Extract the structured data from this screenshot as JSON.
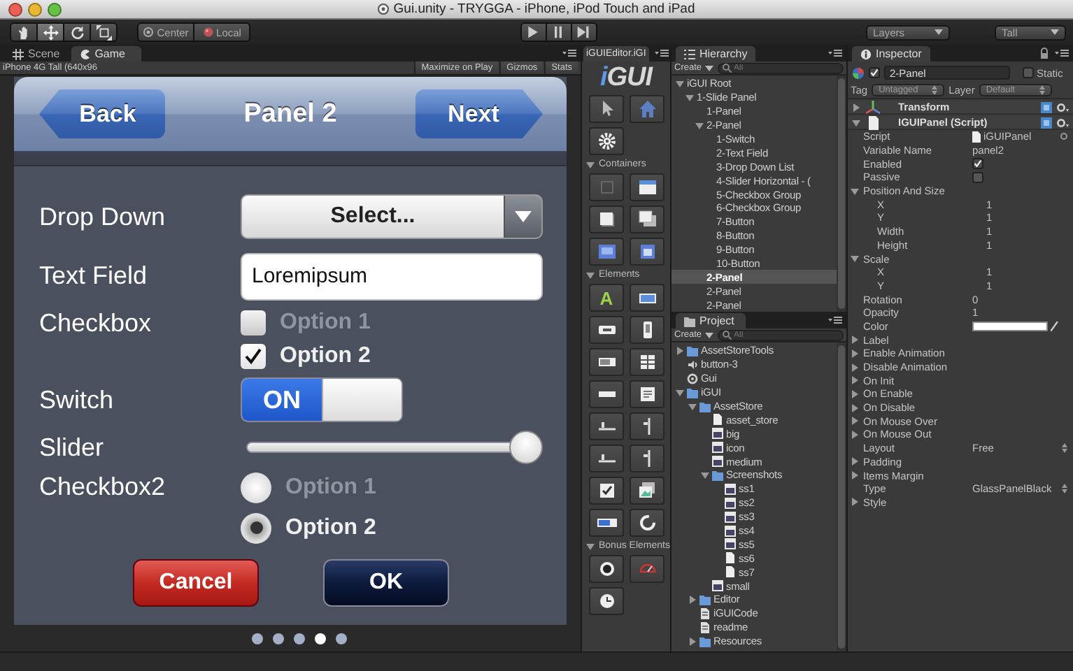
{
  "window": {
    "title": "Gui.unity - TRYGGA - iPhone, iPod Touch and iPad"
  },
  "toolbar": {
    "tools": [
      {
        "kind": "hand",
        "selected": false
      },
      {
        "kind": "move",
        "selected": true
      },
      {
        "kind": "rotate",
        "selected": false
      },
      {
        "kind": "scale",
        "selected": false
      }
    ],
    "pivot": [
      {
        "kind": "center",
        "label": "Center"
      },
      {
        "kind": "local",
        "label": "Local"
      }
    ],
    "playback": [
      {
        "kind": "play"
      },
      {
        "kind": "pause"
      },
      {
        "kind": "step"
      }
    ],
    "layers": "Layers",
    "layout": "Tall"
  },
  "game": {
    "tabs": [
      {
        "kind": "scene",
        "label": "Scene",
        "selected": false
      },
      {
        "kind": "game",
        "label": "Game",
        "selected": true
      }
    ],
    "resolution": "iPhone 4G Tall (640x96",
    "options": [
      "Maximize on Play",
      "Gizmos",
      "Stats"
    ],
    "app": {
      "back": "Back",
      "title": "Panel 2",
      "next": "Next",
      "rows": [
        {
          "kind": "dropdown",
          "label": "Drop Down",
          "value": "Select..."
        },
        {
          "kind": "text",
          "label": "Text Field",
          "value": "Loremipsum"
        },
        {
          "kind": "checkboxes",
          "label": "Checkbox",
          "options": [
            {
              "label": "Option 1",
              "checked": false
            },
            {
              "label": "Option 2",
              "checked": true
            }
          ]
        },
        {
          "kind": "switch",
          "label": "Switch",
          "on": true,
          "text": "ON"
        },
        {
          "kind": "slider",
          "label": "Slider",
          "level": 1
        },
        {
          "kind": "radios",
          "label": "Checkbox2",
          "options": [
            {
              "label": "Option 1",
              "selected": false
            },
            {
              "label": "Option 2",
              "selected": true
            }
          ]
        }
      ],
      "buttons": [
        {
          "kind": "cancel",
          "label": "Cancel"
        },
        {
          "kind": "ok",
          "label": "OK"
        }
      ],
      "pages": [
        {
          "selected": false
        },
        {
          "selected": false
        },
        {
          "selected": false
        },
        {
          "selected": true
        },
        {
          "selected": false
        }
      ]
    }
  },
  "editor": {
    "tab": "iGUIEditor.iGI",
    "logo": "iGUI",
    "sections": [
      {
        "tools": [
          {
            "kind": "pointer"
          },
          {
            "kind": "home"
          },
          {
            "kind": "gear"
          }
        ]
      },
      {
        "label": "Containers",
        "expanded": true,
        "tools": [
          {
            "kind": "blank"
          },
          {
            "kind": "window"
          },
          {
            "kind": "panel"
          },
          {
            "kind": "panels"
          },
          {
            "kind": "scroll"
          },
          {
            "kind": "tabs"
          }
        ]
      },
      {
        "label": "Elements",
        "expanded": true,
        "tools": [
          {
            "kind": "label",
            "glyph": "A"
          },
          {
            "kind": "textfield"
          },
          {
            "kind": "button"
          },
          {
            "kind": "toggle"
          },
          {
            "kind": "listbox"
          },
          {
            "kind": "grid"
          },
          {
            "kind": "line"
          },
          {
            "kind": "textarea"
          },
          {
            "kind": "hslider"
          },
          {
            "kind": "vslider"
          },
          {
            "kind": "hslider"
          },
          {
            "kind": "vslider"
          },
          {
            "kind": "checkbox"
          },
          {
            "kind": "image"
          },
          {
            "kind": "progress"
          },
          {
            "kind": "ring"
          }
        ]
      },
      {
        "label": "Bonus Elements",
        "expanded": true,
        "tools": [
          {
            "kind": "knob"
          },
          {
            "kind": "gauge"
          },
          {
            "kind": "clock"
          }
        ]
      }
    ]
  },
  "hierarchy": {
    "tab": "Hierarchy",
    "create": "Create",
    "search": {
      "placeholder": "All"
    },
    "items": [
      {
        "label": "iGUI Root",
        "selected": false,
        "expanded": true,
        "children": [
          {
            "label": "1-Slide Panel",
            "selected": false,
            "expanded": true,
            "children": [
              {
                "label": "1-Panel",
                "selected": false
              },
              {
                "label": "2-Panel",
                "selected": false,
                "expanded": true,
                "children": [
                  {
                    "label": "1-Switch",
                    "selected": false
                  },
                  {
                    "label": "2-Text Field",
                    "selected": false
                  },
                  {
                    "label": "3-Drop Down List",
                    "selected": false
                  },
                  {
                    "label": "4-Slider Horizontal - (",
                    "selected": false
                  },
                  {
                    "label": "5-Checkbox Group",
                    "selected": false
                  },
                  {
                    "label": "6-Checkbox Group",
                    "selected": false
                  },
                  {
                    "label": "7-Button",
                    "selected": false
                  },
                  {
                    "label": "8-Button",
                    "selected": false
                  },
                  {
                    "label": "9-Button",
                    "selected": false
                  },
                  {
                    "label": "10-Button",
                    "selected": false
                  }
                ]
              },
              {
                "label": "2-Panel",
                "selected": true
              },
              {
                "label": "2-Panel",
                "selected": false
              },
              {
                "label": "2-Panel",
                "selected": false
              }
            ]
          }
        ]
      }
    ]
  },
  "project": {
    "tab": "Project",
    "create": "Create",
    "search": {
      "placeholder": "All"
    },
    "items": [
      {
        "kind": "folder",
        "label": "AssetStoreTools",
        "selected": false,
        "expanded": false
      },
      {
        "kind": "audio",
        "label": "button-3",
        "selected": false
      },
      {
        "kind": "scene",
        "label": "Gui",
        "selected": false
      },
      {
        "kind": "folder",
        "label": "iGUI",
        "selected": false,
        "expanded": true,
        "children": [
          {
            "kind": "folder",
            "label": "AssetStore",
            "selected": false,
            "expanded": true,
            "children": [
              {
                "kind": "page",
                "label": "asset_store",
                "selected": false
              },
              {
                "kind": "image",
                "label": "big",
                "selected": false
              },
              {
                "kind": "image",
                "label": "icon",
                "selected": false
              },
              {
                "kind": "image",
                "label": "medium",
                "selected": false
              },
              {
                "kind": "folder",
                "label": "Screenshots",
                "selected": false,
                "expanded": true,
                "children": [
                  {
                    "kind": "image",
                    "label": "ss1",
                    "selected": false
                  },
                  {
                    "kind": "image",
                    "label": "ss2",
                    "selected": false
                  },
                  {
                    "kind": "image",
                    "label": "ss3",
                    "selected": false
                  },
                  {
                    "kind": "image",
                    "label": "ss4",
                    "selected": false
                  },
                  {
                    "kind": "image",
                    "label": "ss5",
                    "selected": false
                  },
                  {
                    "kind": "page",
                    "label": "ss6",
                    "selected": false
                  },
                  {
                    "kind": "page",
                    "label": "ss7",
                    "selected": false
                  }
                ]
              },
              {
                "kind": "image",
                "label": "small",
                "selected": false
              }
            ]
          },
          {
            "kind": "folder",
            "label": "Editor",
            "selected": false,
            "expanded": false
          },
          {
            "kind": "script",
            "label": "iGUICode",
            "selected": false
          },
          {
            "kind": "script",
            "label": "readme",
            "selected": false
          },
          {
            "kind": "folder",
            "label": "Resources",
            "selected": false,
            "expanded": false
          }
        ]
      }
    ]
  },
  "inspector": {
    "tab": "Inspector",
    "object": {
      "active": true,
      "name": "2-Panel",
      "static_label": "Static",
      "static": false
    },
    "tag_label": "Tag",
    "tag": "Untagged",
    "layer_label": "Layer",
    "layer": "Default",
    "components": [
      {
        "kind": "transform",
        "name": "Transform",
        "expanded": false
      },
      {
        "kind": "script",
        "name": "IGUIPanel (Script)",
        "expanded": true,
        "properties": [
          {
            "kind": "object",
            "label": "Script",
            "value": "iGUIPanel"
          },
          {
            "kind": "text",
            "label": "Variable Name",
            "value": "panel2"
          },
          {
            "kind": "toggle",
            "label": "Enabled",
            "checked": true
          },
          {
            "kind": "toggle",
            "label": "Passive",
            "checked": false
          },
          {
            "kind": "group",
            "label": "Position And Size",
            "expanded": true,
            "children": [
              {
                "kind": "text",
                "label": "X",
                "value": "1"
              },
              {
                "kind": "text",
                "label": "Y",
                "value": "1"
              },
              {
                "kind": "text",
                "label": "Width",
                "value": "1"
              },
              {
                "kind": "text",
                "label": "Height",
                "value": "1"
              }
            ]
          },
          {
            "kind": "group",
            "label": "Scale",
            "expanded": true,
            "children": [
              {
                "kind": "text",
                "label": "X",
                "value": "1"
              },
              {
                "kind": "text",
                "label": "Y",
                "value": "1"
              }
            ]
          },
          {
            "kind": "text",
            "label": "Rotation",
            "value": "0"
          },
          {
            "kind": "text",
            "label": "Opacity",
            "value": "1"
          },
          {
            "kind": "color",
            "label": "Color",
            "color": "#ffffff"
          },
          {
            "kind": "group",
            "label": "Label",
            "expanded": false
          },
          {
            "kind": "group",
            "label": "Enable Animation",
            "expanded": false
          },
          {
            "kind": "group",
            "label": "Disable Animation",
            "expanded": false
          },
          {
            "kind": "group",
            "label": "On Init",
            "expanded": false
          },
          {
            "kind": "group",
            "label": "On Enable",
            "expanded": false
          },
          {
            "kind": "group",
            "label": "On Disable",
            "expanded": false
          },
          {
            "kind": "group",
            "label": "On Mouse Over",
            "expanded": false
          },
          {
            "kind": "group",
            "label": "On Mouse Out",
            "expanded": false
          },
          {
            "kind": "popup",
            "label": "Layout",
            "value": "Free"
          },
          {
            "kind": "group",
            "label": "Padding",
            "expanded": false
          },
          {
            "kind": "group",
            "label": "Items Margin",
            "expanded": false
          },
          {
            "kind": "popup",
            "label": "Type",
            "value": "GlassPanelBlack"
          },
          {
            "kind": "group",
            "label": "Style",
            "expanded": false
          }
        ]
      }
    ]
  }
}
